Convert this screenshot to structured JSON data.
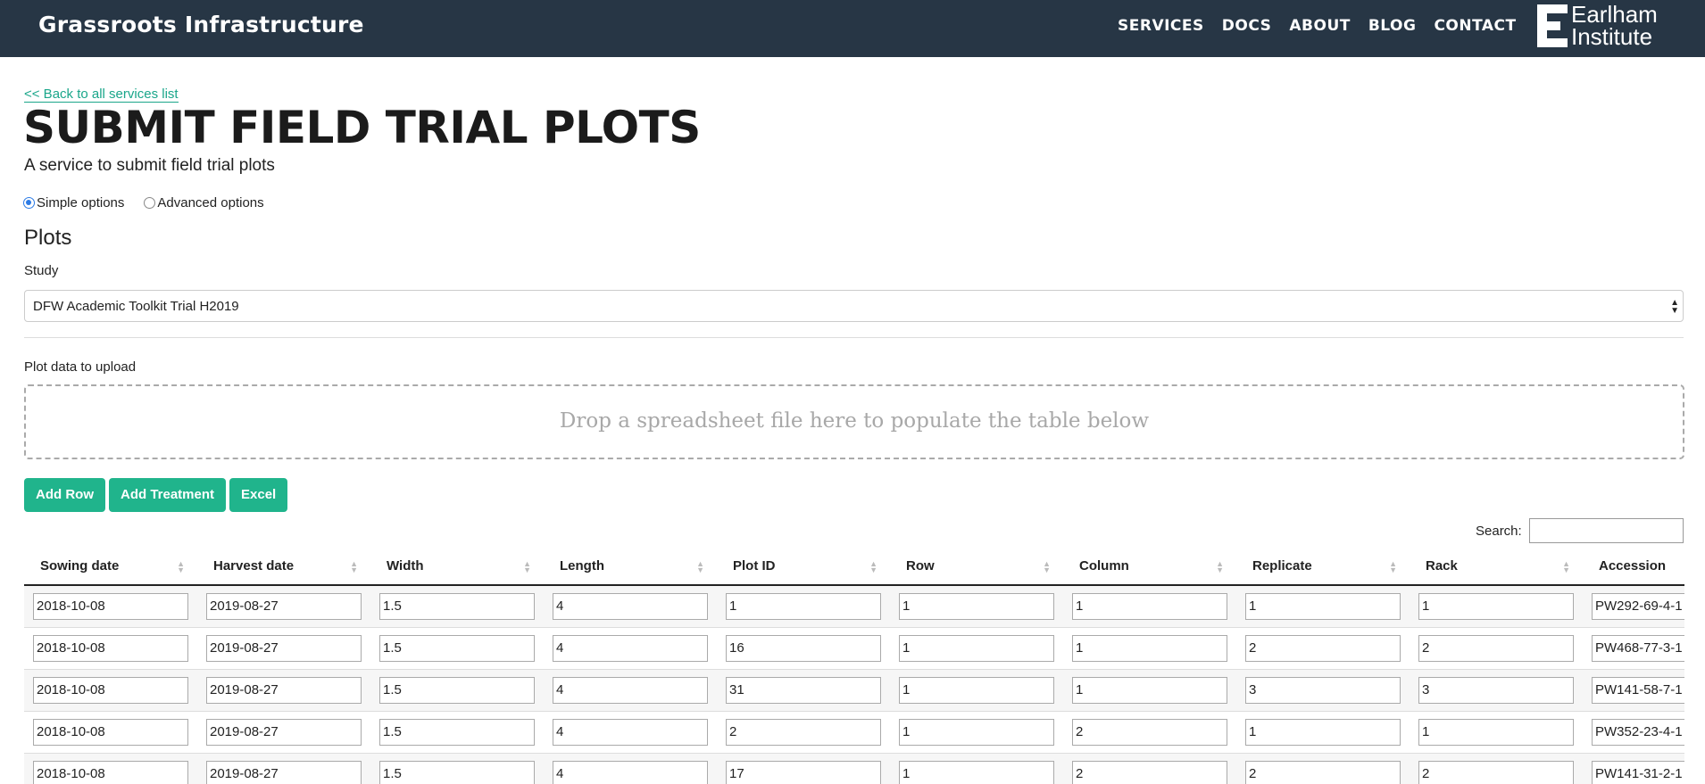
{
  "header": {
    "brand": "Grassroots Infrastructure",
    "nav": [
      "SERVICES",
      "DOCS",
      "ABOUT",
      "BLOG",
      "CONTACT"
    ],
    "logo_line1": "Earlham",
    "logo_line2": "Institute"
  },
  "page": {
    "back_link": "<< Back to all services list",
    "title": "SUBMIT FIELD TRIAL PLOTS",
    "subtitle": "A service to submit field trial plots",
    "options": {
      "simple": "Simple options",
      "advanced": "Advanced options",
      "selected": "simple"
    },
    "section": "Plots",
    "study_label": "Study",
    "study_value": "DFW Academic Toolkit Trial H2019",
    "upload_label": "Plot data to upload",
    "drop_text": "Drop a spreadsheet file here to populate the table below",
    "buttons": {
      "add_row": "Add Row",
      "add_treatment": "Add Treatment",
      "excel": "Excel"
    },
    "search_label": "Search:"
  },
  "table": {
    "columns": [
      "Sowing date",
      "Harvest date",
      "Width",
      "Length",
      "Plot ID",
      "Row",
      "Column",
      "Replicate",
      "Rack",
      "Accession"
    ],
    "rows": [
      [
        "2018-10-08",
        "2019-08-27",
        "1.5",
        "4",
        "1",
        "1",
        "1",
        "1",
        "1",
        "PW292-69-4-1"
      ],
      [
        "2018-10-08",
        "2019-08-27",
        "1.5",
        "4",
        "16",
        "1",
        "1",
        "2",
        "2",
        "PW468-77-3-1"
      ],
      [
        "2018-10-08",
        "2019-08-27",
        "1.5",
        "4",
        "31",
        "1",
        "1",
        "3",
        "3",
        "PW141-58-7-1"
      ],
      [
        "2018-10-08",
        "2019-08-27",
        "1.5",
        "4",
        "2",
        "1",
        "2",
        "1",
        "1",
        "PW352-23-4-1"
      ],
      [
        "2018-10-08",
        "2019-08-27",
        "1.5",
        "4",
        "17",
        "1",
        "2",
        "2",
        "2",
        "PW141-31-2-1"
      ]
    ]
  }
}
